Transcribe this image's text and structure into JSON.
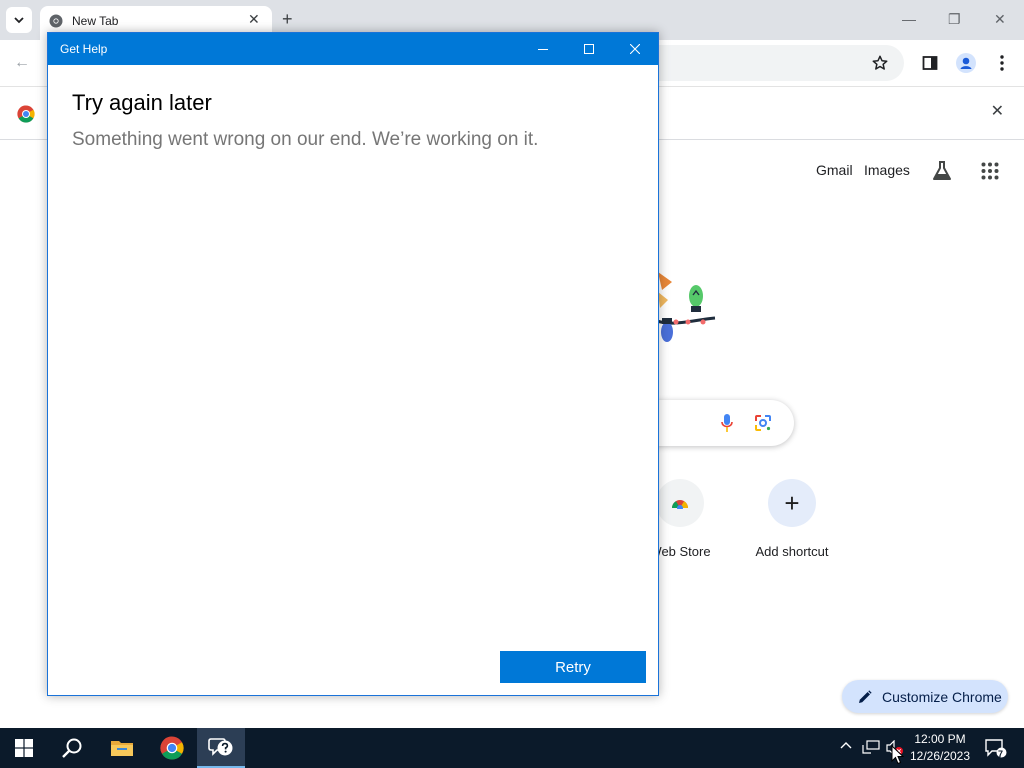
{
  "browser": {
    "tab_title": "New Tab",
    "new_tab_symbol": "+",
    "tab_close_symbol": "✕",
    "window_controls": {
      "minimize": "—",
      "restore": "❐",
      "close": "✕"
    },
    "infobar_close_symbol": "✕"
  },
  "ntp": {
    "links": [
      "Gmail",
      "Images"
    ],
    "shortcuts": [
      {
        "label": "Web Store",
        "icon": "chrome-web-store-icon"
      },
      {
        "label": "Add shortcut",
        "icon": "plus-icon",
        "symbol": "+"
      }
    ],
    "customize_label": "Customize Chrome"
  },
  "dialog": {
    "title": "Get Help",
    "heading": "Try again later",
    "message": "Something went wrong on our end. We’re working on it.",
    "retry_label": "Retry"
  },
  "taskbar": {
    "apps": [
      "start-icon",
      "search-icon",
      "file-explorer-icon",
      "chrome-icon",
      "get-help-icon"
    ],
    "active_app": "get-help-icon",
    "time": "12:00 PM",
    "date": "12/26/2023",
    "notification_count": "7"
  },
  "colors": {
    "dialog_accent": "#0078d7",
    "taskbar_bg": "#0b1a2a",
    "tabstrip_bg": "#dee1e6",
    "customize_bg": "#d3e3fd"
  }
}
